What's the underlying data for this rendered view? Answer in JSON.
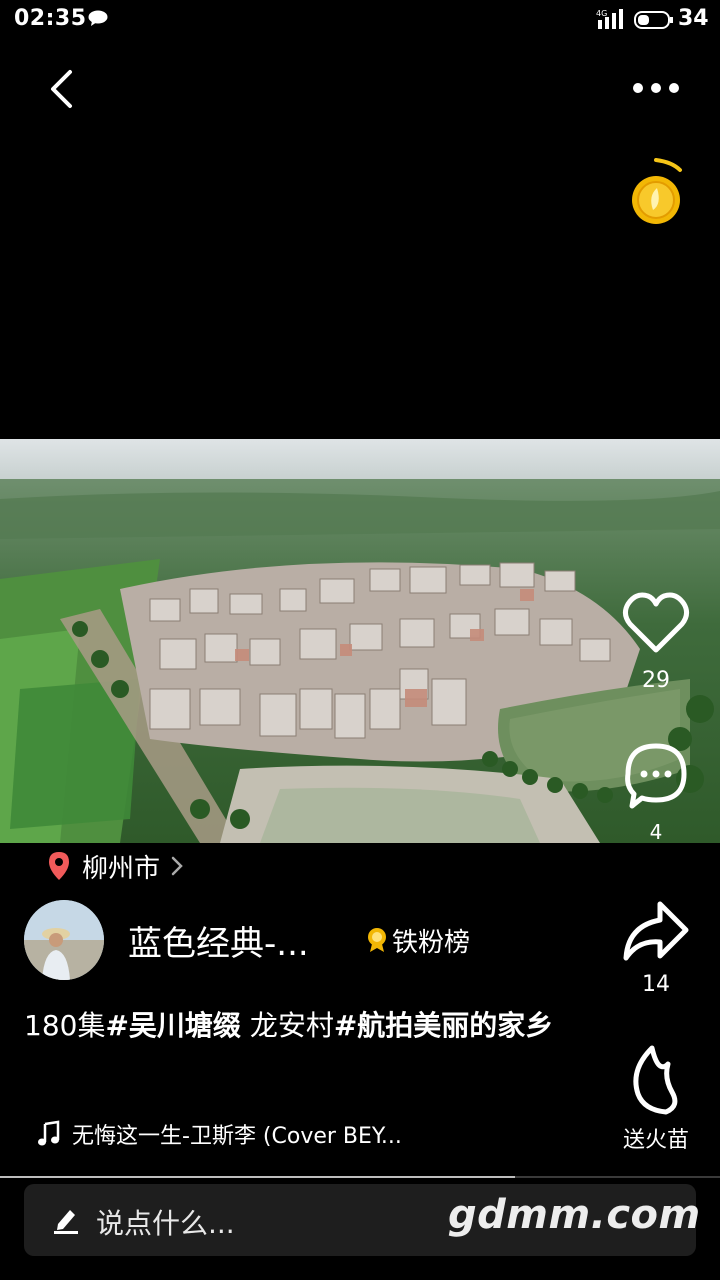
{
  "status_bar": {
    "time": "02:35",
    "network": "4G",
    "battery": "34"
  },
  "video": {
    "location": "柳州市",
    "like_count": "29",
    "comment_count": "4",
    "share_count": "14",
    "fire_label": "送火苗",
    "progress": 0.715
  },
  "author": {
    "name": "蓝色经典-...",
    "fans_board": "铁粉榜"
  },
  "caption": {
    "part1": "180集",
    "tag1": "#吴川塘缀",
    "part2": "  龙安村",
    "tag2": "#航拍美丽的家乡"
  },
  "music": {
    "title": "无悔这一生-卫斯李 (Cover BEY..."
  },
  "comment_input": {
    "placeholder": "说点什么..."
  },
  "watermark": "gdmm.com",
  "icons": [
    "back-icon",
    "more-icon",
    "coin-icon",
    "heart-icon",
    "comment-icon",
    "share-icon",
    "fire-icon",
    "location-pin-icon",
    "music-note-icon",
    "pen-icon"
  ]
}
